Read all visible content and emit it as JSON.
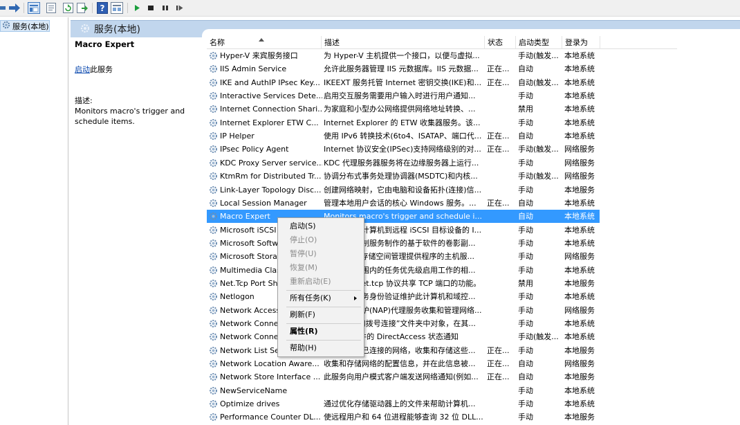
{
  "tree": {
    "root_label": "服务(本地)"
  },
  "panel": {
    "title": "服务(本地)"
  },
  "details": {
    "service_name": "Macro Expert",
    "start_link": "启动",
    "start_suffix": "此服务",
    "desc_label": "描述:",
    "desc_text": "Monitors macro's trigger and schedule items."
  },
  "columns": {
    "name": "名称",
    "description": "描述",
    "status": "状态",
    "startup": "启动类型",
    "logon": "登录为"
  },
  "services": [
    {
      "name": "Hyper-V 来宾服务接口",
      "desc": "为 Hyper-V 主机提供一个接口，以便与虚拟...",
      "status": "",
      "startup": "手动(触发...",
      "logon": "本地系统"
    },
    {
      "name": "IIS Admin Service",
      "desc": "允许此服务器管理 IIS 元数据库。IIS 元数据...",
      "status": "正在...",
      "startup": "自动",
      "logon": "本地系统"
    },
    {
      "name": "IKE and AuthIP IPsec Key...",
      "desc": "IKEEXT 服务托管 Internet 密钥交换(IKE)和...",
      "status": "正在...",
      "startup": "自动(触发...",
      "logon": "本地系统"
    },
    {
      "name": "Interactive Services Dete...",
      "desc": "启用交互服务需要用户输入时进行用户通知...",
      "status": "",
      "startup": "手动",
      "logon": "本地系统"
    },
    {
      "name": "Internet Connection Shari...",
      "desc": "为家庭和小型办公网络提供网络地址转换、...",
      "status": "",
      "startup": "禁用",
      "logon": "本地系统"
    },
    {
      "name": "Internet Explorer ETW C...",
      "desc": "Internet Explorer 的 ETW 收集器服务。该...",
      "status": "",
      "startup": "手动",
      "logon": "本地系统"
    },
    {
      "name": "IP Helper",
      "desc": "使用 IPv6 转换技术(6to4、ISATAP、端口代...",
      "status": "正在...",
      "startup": "自动",
      "logon": "本地系统"
    },
    {
      "name": "IPsec Policy Agent",
      "desc": "Internet 协议安全(IPSec)支持网络级别的对...",
      "status": "正在...",
      "startup": "手动(触发...",
      "logon": "网络服务"
    },
    {
      "name": "KDC Proxy Server service...",
      "desc": "KDC 代理服务器服务将在边缘服务器上运行...",
      "status": "",
      "startup": "手动",
      "logon": "网络服务"
    },
    {
      "name": "KtmRm for Distributed Tr...",
      "desc": "协调分布式事务处理协调器(MSDTC)和内核...",
      "status": "",
      "startup": "手动(触发...",
      "logon": "网络服务"
    },
    {
      "name": "Link-Layer Topology Disc...",
      "desc": "创建网络映射，它由电脑和设备拓扑(连接)信...",
      "status": "",
      "startup": "手动",
      "logon": "本地服务"
    },
    {
      "name": "Local Session Manager",
      "desc": "管理本地用户会话的核心 Windows 服务。...",
      "status": "正在...",
      "startup": "自动",
      "logon": "本地系统"
    },
    {
      "name": "Macro Expert",
      "desc": "Monitors macro's trigger and schedule i...",
      "status": "",
      "startup": "自动",
      "logon": "本地系统"
    },
    {
      "name": "Microsoft iSCSI Initiator...",
      "desc": "管理从这台计算机到远程 iSCSI 目标设备的 I...",
      "status": "",
      "startup": "手动",
      "logon": "本地系统"
    },
    {
      "name": "Microsoft Software Shad...",
      "desc": "管理卷影复制服务制作的基于软件的卷影副...",
      "status": "",
      "startup": "手动",
      "logon": "本地系统"
    },
    {
      "name": "Microsoft Storage Space...",
      "desc": "Microsoft 存储空间管理提供程序的主机服...",
      "status": "",
      "startup": "手动",
      "logon": "网络服务"
    },
    {
      "name": "Multimedia Class Sched...",
      "desc": "基于系统范围内的任务优先级启用工作的相...",
      "status": "",
      "startup": "手动",
      "logon": "本地系统"
    },
    {
      "name": "Net.Tcp Port Sharing Se...",
      "desc": "提供通过 net.tcp 协议共享 TCP 端口的功能。",
      "status": "",
      "startup": "禁用",
      "logon": "本地服务"
    },
    {
      "name": "Netlogon",
      "desc": "为用户和服务身份验证维护此计算机和域控...",
      "status": "",
      "startup": "手动",
      "logon": "本地系统"
    },
    {
      "name": "Network Access Protecti...",
      "desc": "网络访问保护(NAP)代理服务收集和管理网络...",
      "status": "",
      "startup": "手动",
      "logon": "网络服务"
    },
    {
      "name": "Network Connections",
      "desc": "管理“网络和拨号连接”文件夹中对象，在其...",
      "status": "",
      "startup": "手动",
      "logon": "本地系统"
    },
    {
      "name": "Network Connectivity As...",
      "desc": "提供 UI 组件的 DirectAccess 状态通知",
      "status": "",
      "startup": "手动(触发...",
      "logon": "本地系统"
    },
    {
      "name": "Network List Service",
      "desc": "识别计算机已连接的网络，收集和存储这些...",
      "status": "正在...",
      "startup": "手动",
      "logon": "本地服务"
    },
    {
      "name": "Network Location Aware...",
      "desc": "收集和存储网络的配置信息，并在此信息被...",
      "status": "正在...",
      "startup": "自动",
      "logon": "网络服务"
    },
    {
      "name": "Network Store Interface ...",
      "desc": "此服务向用户模式客户端发送网络通知(例如...",
      "status": "正在...",
      "startup": "自动",
      "logon": "本地服务"
    },
    {
      "name": "NewServiceName",
      "desc": "",
      "status": "",
      "startup": "手动",
      "logon": "本地系统"
    },
    {
      "name": "Optimize drives",
      "desc": "通过优化存储驱动器上的文件来帮助计算机...",
      "status": "",
      "startup": "手动",
      "logon": "本地系统"
    },
    {
      "name": "Performance Counter DL...",
      "desc": "使远程用户和 64 位进程能够查询 32 位 DLL...",
      "status": "",
      "startup": "手动",
      "logon": "本地服务"
    }
  ],
  "context_menu": {
    "start": "启动(S)",
    "stop": "停止(O)",
    "pause": "暂停(U)",
    "resume": "恢复(M)",
    "restart": "重新启动(E)",
    "all_tasks": "所有任务(K)",
    "refresh": "刷新(F)",
    "properties": "属性(R)",
    "help": "帮助(H)"
  },
  "colors": {
    "selection": "#3399ff",
    "header_band": "#c1d6ed",
    "link": "#0645ad",
    "play_green": "#1a9e3c"
  },
  "icons": [
    "back-icon",
    "forward-icon",
    "console-tree-icon",
    "properties-icon",
    "refresh-icon",
    "export-icon",
    "help-icon",
    "view-icon",
    "play-icon",
    "stop-icon",
    "pause-icon",
    "restart-icon",
    "gear-icon"
  ]
}
